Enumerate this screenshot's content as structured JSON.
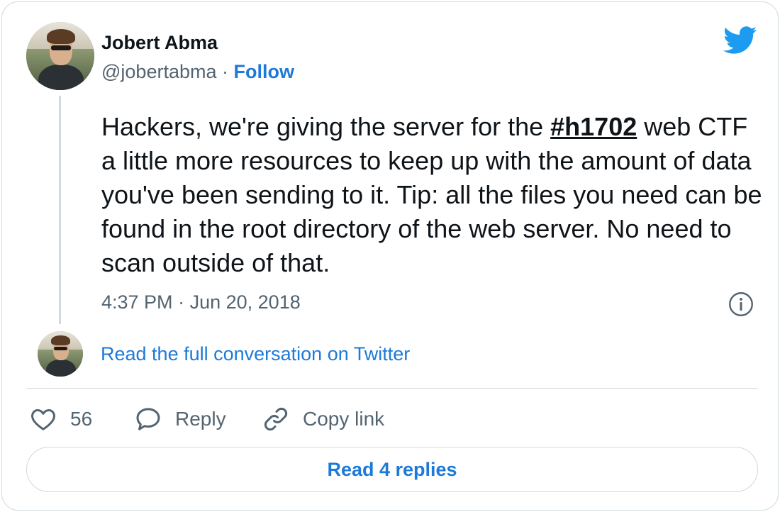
{
  "author": {
    "name": "Jobert Abma",
    "handle": "@jobertabma",
    "separator": "·",
    "follow_label": "Follow"
  },
  "tweet": {
    "text_before": "Hackers, we're giving the server for the ",
    "hashtag": "#h1702",
    "text_after": " web CTF a little more resources to keep up with the amount of data you've been sending to it. Tip: all the files you need can be found in the root directory of the web server. No need to scan outside of that.",
    "time": "4:37 PM",
    "time_separator": "·",
    "date": "Jun 20, 2018"
  },
  "conversation_link": "Read the full conversation on Twitter",
  "actions": {
    "like_count": "56",
    "reply_label": "Reply",
    "copy_label": "Copy link"
  },
  "read_replies_label": "Read 4 replies",
  "icons": {
    "brand": "twitter-bird-icon",
    "info": "info-icon",
    "like": "heart-icon",
    "reply": "speech-bubble-icon",
    "copy": "link-icon"
  },
  "colors": {
    "link": "#1d7ad8",
    "twitter_blue": "#1d9bf0",
    "muted": "#536471",
    "border": "#cfd9de",
    "text": "#0f1419"
  }
}
